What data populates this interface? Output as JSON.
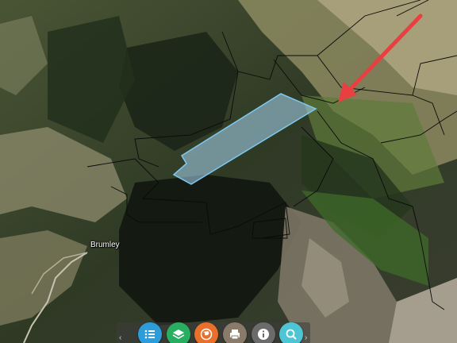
{
  "map": {
    "place_label": "Brumley",
    "selected_parcel_color": "#7ec8f0",
    "pointer_arrow_color": "#e84040"
  },
  "toolbar": {
    "buttons": [
      {
        "name": "legend",
        "icon": "list-icon",
        "color": "#2d9cdb"
      },
      {
        "name": "layers",
        "icon": "layers-icon",
        "color": "#27ae60"
      },
      {
        "name": "basemap",
        "icon": "globe-icon",
        "color": "#e8702a"
      },
      {
        "name": "print",
        "icon": "printer-icon",
        "color": "#8a7a6a"
      },
      {
        "name": "info",
        "icon": "info-icon",
        "color": "#6b6b6b"
      },
      {
        "name": "search",
        "icon": "search-icon",
        "color": "#4ec5d4"
      }
    ]
  }
}
